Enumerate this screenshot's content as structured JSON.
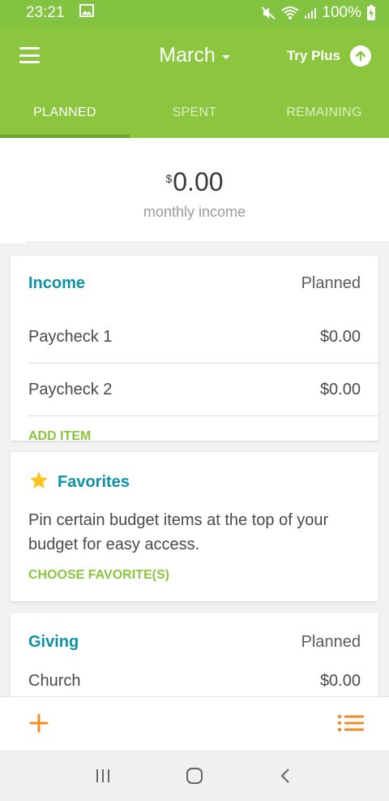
{
  "status": {
    "time": "23:21",
    "battery": "100%"
  },
  "appbar": {
    "month": "March",
    "try_plus": "Try Plus"
  },
  "tabs": [
    {
      "label": "PLANNED",
      "active": true
    },
    {
      "label": "SPENT",
      "active": false
    },
    {
      "label": "REMAINING",
      "active": false
    }
  ],
  "summary": {
    "currency": "$",
    "amount": "0.00",
    "label": "monthly income"
  },
  "income": {
    "title": "Income",
    "column": "Planned",
    "items": [
      {
        "name": "Paycheck 1",
        "amount": "$0.00"
      },
      {
        "name": "Paycheck 2",
        "amount": "$0.00"
      }
    ],
    "action": "ADD ITEM"
  },
  "favorites": {
    "title": "Favorites",
    "description": "Pin certain budget items at the top of your budget for easy access.",
    "action": "CHOOSE FAVORITE(S)"
  },
  "giving": {
    "title": "Giving",
    "column": "Planned",
    "items": [
      {
        "name": "Church",
        "amount": "$0.00"
      }
    ]
  },
  "colors": {
    "primary_green": "#8cc63f",
    "teal": "#0e93a6",
    "orange": "#f08a24",
    "star": "#f8c51c"
  },
  "icons": {
    "menu": "hamburger-icon",
    "upgrade": "arrow-up-circle-icon",
    "add": "plus-icon",
    "list": "list-icon",
    "favorite": "star-icon"
  }
}
